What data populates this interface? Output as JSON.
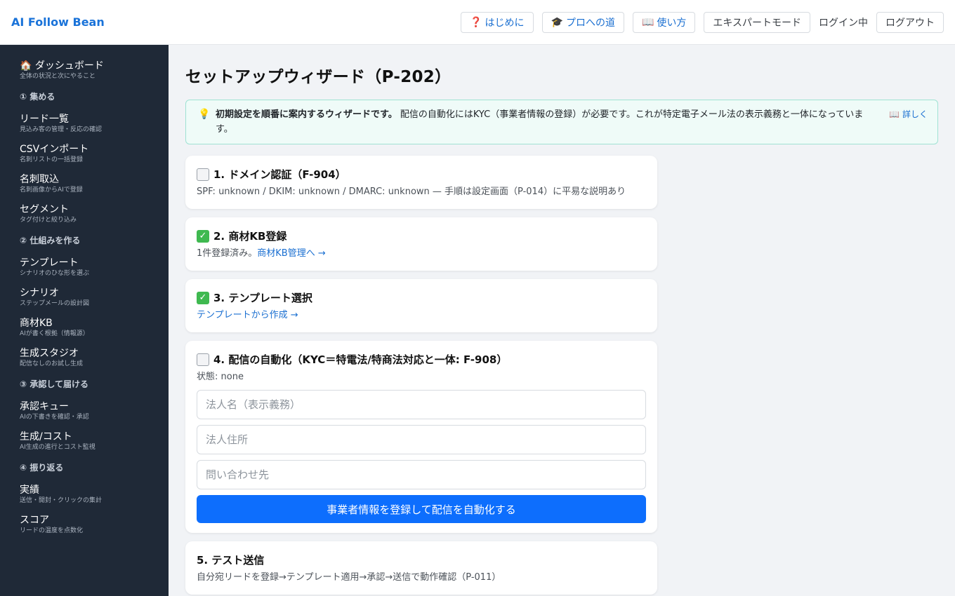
{
  "header": {
    "brand": "AI Follow Bean",
    "nav": [
      {
        "icon": "question-icon",
        "glyph": "❓",
        "label": "はじめに"
      },
      {
        "icon": "graduation-cap-icon",
        "glyph": "🎓",
        "label": "プロへの道"
      },
      {
        "icon": "book-icon",
        "glyph": "📖",
        "label": "使い方"
      }
    ],
    "expert_mode": "エキスパートモード",
    "login_status": "ログイン中",
    "logout": "ログアウト"
  },
  "sidebar": {
    "dashboard": {
      "icon": "house-icon",
      "glyph": "🏠",
      "label": "ダッシュボード",
      "sub": "全体の状況と次にやること"
    },
    "groups": [
      {
        "label": "① 集める",
        "items": [
          {
            "label": "リード一覧",
            "sub": "見込み客の管理・反応の確認"
          },
          {
            "label": "CSVインポート",
            "sub": "名刺リストの一括登録"
          },
          {
            "label": "名刺取込",
            "sub": "名刺画像からAIで登録"
          },
          {
            "label": "セグメント",
            "sub": "タグ付けと絞り込み"
          }
        ]
      },
      {
        "label": "② 仕組みを作る",
        "items": [
          {
            "label": "テンプレート",
            "sub": "シナリオのひな形を選ぶ"
          },
          {
            "label": "シナリオ",
            "sub": "ステップメールの設計図"
          },
          {
            "label": "商材KB",
            "sub": "AIが書く根拠（情報源）"
          },
          {
            "label": "生成スタジオ",
            "sub": "配信なしのお試し生成"
          }
        ]
      },
      {
        "label": "③ 承認して届ける",
        "items": [
          {
            "label": "承認キュー",
            "sub": "AIの下書きを確認・承認"
          },
          {
            "label": "生成/コスト",
            "sub": "AI生成の進行とコスト監視"
          }
        ]
      },
      {
        "label": "④ 振り返る",
        "items": [
          {
            "label": "実績",
            "sub": "送信・開封・クリックの集計"
          },
          {
            "label": "スコア",
            "sub": "リードの温度を点数化"
          }
        ]
      }
    ]
  },
  "main": {
    "title": "セットアップウィザード（P-202）",
    "info": {
      "icon": "lightbulb-icon",
      "bold": "初期設定を順番に案内するウィザードです。",
      "text": "配信の自動化にはKYC（事業者情報の登録）が必要です。これが特定電子メール法の表示義務と一体になっています。",
      "detail": "📖 詳しく"
    },
    "steps": {
      "s1": {
        "status": "todo",
        "title": "1. ドメイン認証（F-904）",
        "text": "SPF: unknown / DKIM: unknown / DMARC: unknown — 手順は設定画面（P-014）に平易な説明あり"
      },
      "s2": {
        "status": "done",
        "title": "2. 商材KB登録",
        "text": "1件登録済み。",
        "link": "商材KB管理へ →"
      },
      "s3": {
        "status": "done",
        "title": "3. テンプレート選択",
        "link": "テンプレートから作成 →"
      },
      "s4": {
        "status": "todo",
        "title": "4. 配信の自動化（KYC＝特電法/特商法対応と一体: F-908）",
        "state": "状態: none",
        "ph_name": "法人名（表示義務）",
        "ph_address": "法人住所",
        "ph_contact": "問い合わせ先",
        "submit": "事業者情報を登録して配信を自動化する"
      },
      "s5": {
        "title": "5. テスト送信",
        "text": "自分宛リードを登録→テンプレート適用→承認→送信で動作確認（P-011）"
      }
    }
  }
}
